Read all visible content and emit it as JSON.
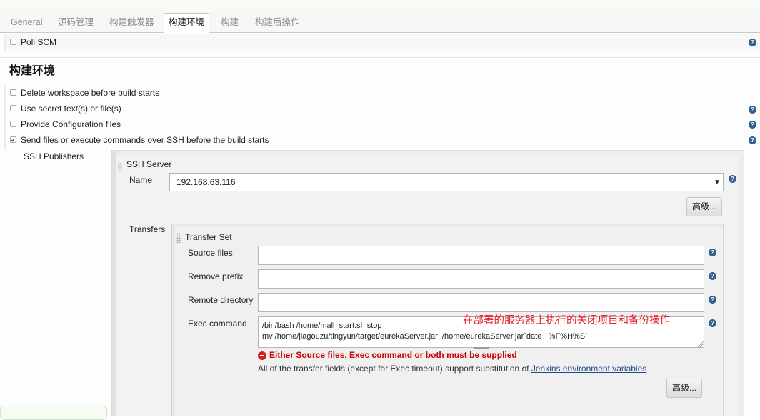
{
  "tabs": [
    {
      "label": "General"
    },
    {
      "label": "源码管理"
    },
    {
      "label": "构建触发器"
    },
    {
      "label": "构建环境",
      "active": true
    },
    {
      "label": "构建"
    },
    {
      "label": "构建后操作"
    }
  ],
  "poll_scm": {
    "label": "Poll SCM",
    "checked": false
  },
  "section": {
    "title": "构建环境"
  },
  "options": [
    {
      "label": "Delete workspace before build starts",
      "checked": false
    },
    {
      "label": "Use secret text(s) or file(s)",
      "checked": false
    },
    {
      "label": "Provide Configuration files",
      "checked": false
    },
    {
      "label": "Send files or execute commands over SSH before the build starts",
      "checked": true
    }
  ],
  "ssh": {
    "publishers_label": "SSH Publishers",
    "server_title": "SSH Server",
    "name_label": "Name",
    "name_value": "192.168.63.116",
    "advanced_label": "高级...",
    "transfers_label": "Transfers",
    "transfer_set_title": "Transfer Set",
    "source_files_label": "Source files",
    "source_files_value": "",
    "remove_prefix_label": "Remove prefix",
    "remove_prefix_value": "",
    "remote_directory_label": "Remote directory",
    "remote_directory_value": "",
    "exec_command_label": "Exec command",
    "exec_command_value": "/bin/bash /home/mall_start.sh stop\nmv /home/jiagouzu/tingyun/target/eurekaServer.jar  /home/eurekaServer.jar`date +%F%H%S`",
    "annotation": "在部署的服务器上执行的关闭项目和备份操作",
    "error_text": "Either Source files, Exec command or both must be supplied",
    "info_text": "All of the transfer fields (except for Exec timeout) support substitution of ",
    "info_link": "Jenkins environment variables",
    "transfer_advanced_label": "高级..."
  },
  "icons": {
    "help": "help-icon",
    "error": "error-icon",
    "dropdown": "chevron-down-icon"
  },
  "colors": {
    "error": "#cc0000",
    "annotation": "#e8222a",
    "link": "#204a87",
    "help": "#365f91"
  }
}
